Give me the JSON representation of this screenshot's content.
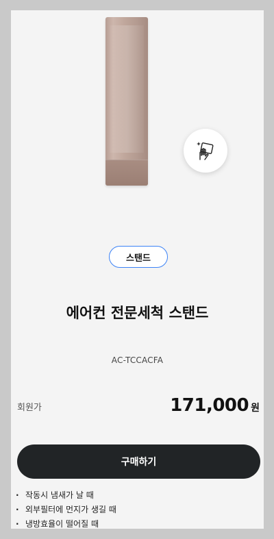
{
  "product": {
    "category": "스탠드",
    "title": "에어컨 전문세척 스탠드",
    "model": "AC-TCCACFA"
  },
  "price": {
    "label": "회원가",
    "value": "171,000",
    "unit": "원"
  },
  "actions": {
    "buy_label": "구매하기"
  },
  "symptoms": [
    "작동시 냄새가 날 때",
    "외부필터에 먼지가 생길 때",
    "냉방효율이 떨어질 때"
  ],
  "icons": {
    "badge": "cleaning-hand-icon"
  }
}
